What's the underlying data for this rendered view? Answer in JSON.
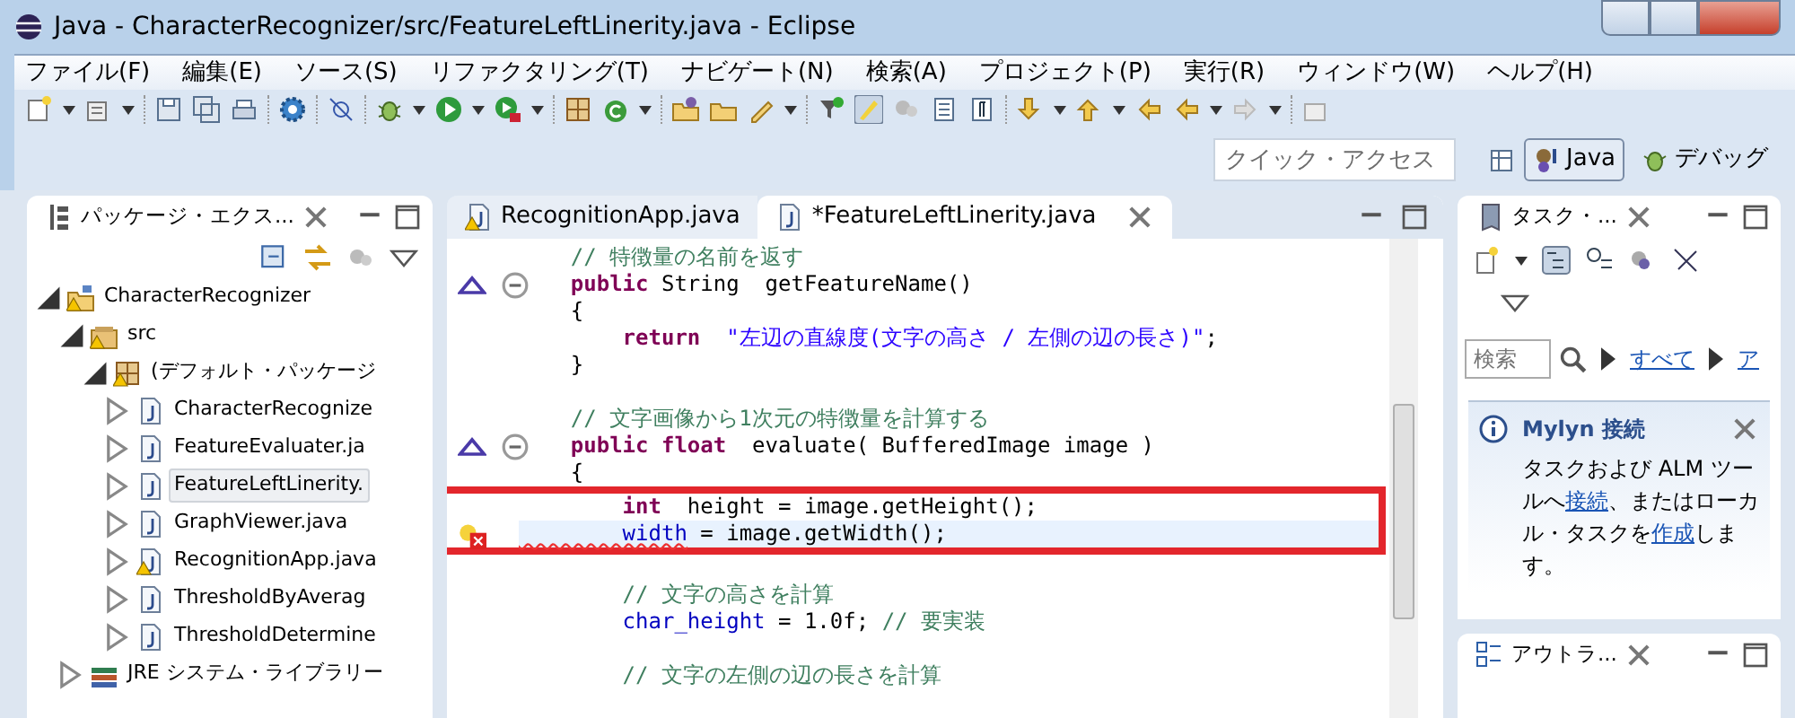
{
  "window": {
    "title": "Java - CharacterRecognizer/src/FeatureLeftLinerity.java - Eclipse"
  },
  "menu": [
    "ファイル(F)",
    "編集(E)",
    "ソース(S)",
    "リファクタリング(T)",
    "ナビゲート(N)",
    "検索(A)",
    "プロジェクト(P)",
    "実行(R)",
    "ウィンドウ(W)",
    "ヘルプ(H)"
  ],
  "quick_access": {
    "placeholder": "クイック・アクセス"
  },
  "perspectives": [
    {
      "label": "Java",
      "selected": true
    },
    {
      "label": "デバッグ",
      "selected": false
    }
  ],
  "package_explorer": {
    "title": "パッケージ・エクス...",
    "tree": [
      {
        "label": "CharacterRecognizer",
        "kind": "project",
        "expanded": true,
        "selected": false,
        "warning": true,
        "children": [
          {
            "label": "src",
            "kind": "source",
            "expanded": true,
            "selected": false,
            "warning": true,
            "children": [
              {
                "label": "(デフォルト・パッケージ",
                "kind": "package",
                "expanded": true,
                "selected": false,
                "warning": true,
                "children": [
                  {
                    "label": "CharacterRecognize",
                    "kind": "file",
                    "expanded": false,
                    "selected": false,
                    "warning": false
                  },
                  {
                    "label": "FeatureEvaluater.ja",
                    "kind": "file",
                    "expanded": false,
                    "selected": false,
                    "warning": false
                  },
                  {
                    "label": "FeatureLeftLinerity.",
                    "kind": "file",
                    "expanded": false,
                    "selected": true,
                    "warning": false
                  },
                  {
                    "label": "GraphViewer.java",
                    "kind": "file",
                    "expanded": false,
                    "selected": false,
                    "warning": false
                  },
                  {
                    "label": "RecognitionApp.java",
                    "kind": "file",
                    "expanded": false,
                    "selected": false,
                    "warning": true
                  },
                  {
                    "label": "ThresholdByAverag",
                    "kind": "file",
                    "expanded": false,
                    "selected": false,
                    "warning": false
                  },
                  {
                    "label": "ThresholdDetermine",
                    "kind": "file",
                    "expanded": false,
                    "selected": false,
                    "warning": false
                  }
                ]
              }
            ]
          },
          {
            "label": "JRE システム・ライブラリー",
            "kind": "library",
            "expanded": false,
            "selected": false,
            "warning": false
          }
        ]
      }
    ]
  },
  "editor": {
    "tabs": [
      {
        "label": "RecognitionApp.java",
        "selected": false,
        "warning": true
      },
      {
        "label": "*FeatureLeftLinerity.java",
        "selected": true,
        "warning": false
      }
    ],
    "lines": [
      {
        "kind": "code",
        "segments": [
          {
            "kind": "comment",
            "text": "    // 特徴量の名前を返す"
          }
        ]
      },
      {
        "kind": "code",
        "fold": true,
        "override": true,
        "segments": [
          {
            "kind": "keyword",
            "text": "    public"
          },
          {
            "kind": "plain",
            "text": " String  getFeatureName()"
          }
        ]
      },
      {
        "kind": "code",
        "segments": [
          {
            "kind": "plain",
            "text": "    {"
          }
        ]
      },
      {
        "kind": "code",
        "segments": [
          {
            "kind": "keyword",
            "text": "        return"
          },
          {
            "kind": "string",
            "text": "  \"左辺の直線度(文字の高さ / 左側の辺の長さ)\""
          },
          {
            "kind": "plain",
            "text": ";"
          }
        ]
      },
      {
        "kind": "code",
        "segments": [
          {
            "kind": "plain",
            "text": "    }"
          }
        ]
      },
      {
        "kind": "blank"
      },
      {
        "kind": "code",
        "segments": [
          {
            "kind": "comment",
            "text": "    // 文字画像から1次元の特徴量を計算する"
          }
        ]
      },
      {
        "kind": "code",
        "fold": true,
        "override": true,
        "segments": [
          {
            "kind": "keyword",
            "text": "    public float"
          },
          {
            "kind": "plain",
            "text": "  evaluate( BufferedImage image )"
          }
        ]
      },
      {
        "kind": "code",
        "segments": [
          {
            "kind": "plain",
            "text": "    {"
          }
        ]
      },
      {
        "kind": "code",
        "framed": true,
        "segments": [
          {
            "kind": "keyword",
            "text": "        int"
          },
          {
            "kind": "plain",
            "text": "  height = image.getHeight();"
          }
        ]
      },
      {
        "kind": "code",
        "framed": true,
        "current": true,
        "error": true,
        "segments": [
          {
            "kind": "field",
            "text": "        width",
            "error": true
          },
          {
            "kind": "plain",
            "text": " = image.getWidth();"
          }
        ]
      },
      {
        "kind": "blank"
      },
      {
        "kind": "code",
        "segments": [
          {
            "kind": "comment",
            "text": "        // 文字の高さを計算"
          }
        ]
      },
      {
        "kind": "code",
        "segments": [
          {
            "kind": "field",
            "text": "        char_height"
          },
          {
            "kind": "plain",
            "text": " = 1.0f; "
          },
          {
            "kind": "comment",
            "text": "// 要実装"
          }
        ]
      },
      {
        "kind": "blank"
      },
      {
        "kind": "code",
        "segments": [
          {
            "kind": "comment",
            "text": "        // 文字の左側の辺の長さを計算"
          }
        ]
      }
    ]
  },
  "task_list": {
    "title": "タスク・...",
    "search": {
      "placeholder": "検索"
    },
    "filters": [
      "すべて",
      "ア"
    ]
  },
  "mylyn": {
    "title": "Mylyn 接続",
    "message": [
      {
        "text": "タスクおよび ALM ツールへ",
        "link": false
      },
      {
        "text": "接続",
        "link": true
      },
      {
        "text": "、またはローカル・タスクを",
        "link": false
      },
      {
        "text": "作成",
        "link": true
      },
      {
        "text": "します。",
        "link": false
      }
    ]
  },
  "outline": {
    "title": "アウトラ..."
  }
}
